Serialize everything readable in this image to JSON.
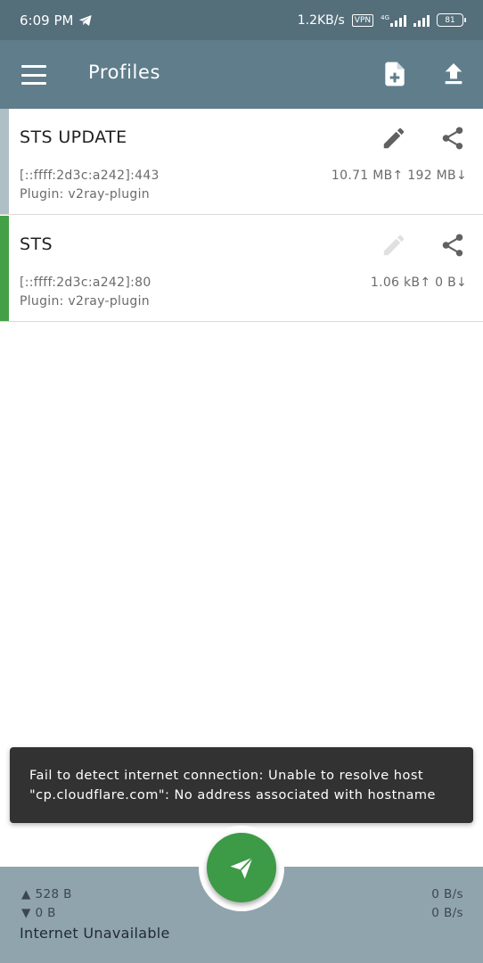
{
  "status_bar": {
    "time": "6:09 PM",
    "net_speed": "1.2KB/s",
    "vpn": "VPN",
    "network_type": "4G",
    "battery": "81"
  },
  "toolbar": {
    "title": "Profiles",
    "icons": [
      "menu-icon",
      "add-file-icon",
      "upload-icon"
    ]
  },
  "profiles": [
    {
      "name": "STS UPDATE",
      "server": "[::ffff:2d3c:a242]:443",
      "plugin": "Plugin: v2ray-plugin",
      "traffic": "10.71 MB↑  192 MB↓",
      "accent": "#b0bec5",
      "edit_enabled": true
    },
    {
      "name": "STS",
      "server": "[::ffff:2d3c:a242]:80",
      "plugin": "Plugin: v2ray-plugin",
      "traffic": "1.06 kB↑  0 B↓",
      "accent": "#43a047",
      "edit_enabled": false
    }
  ],
  "snackbar": {
    "line1": "Fail to detect internet connection: Unable to resolve host",
    "line2": "\"cp.cloudflare.com\": No address associated with hostname"
  },
  "bottom": {
    "tx_total": "▲ 528 B",
    "rx_total": "▼ 0 B",
    "tx_rate": "0 B/s",
    "rx_rate": "0 B/s",
    "connection_status": "Internet Unavailable"
  },
  "colors": {
    "status_bar": "#546e7a",
    "toolbar": "#607d8b",
    "fab": "#3d9a47",
    "bottom_bar": "#90a4ae"
  }
}
